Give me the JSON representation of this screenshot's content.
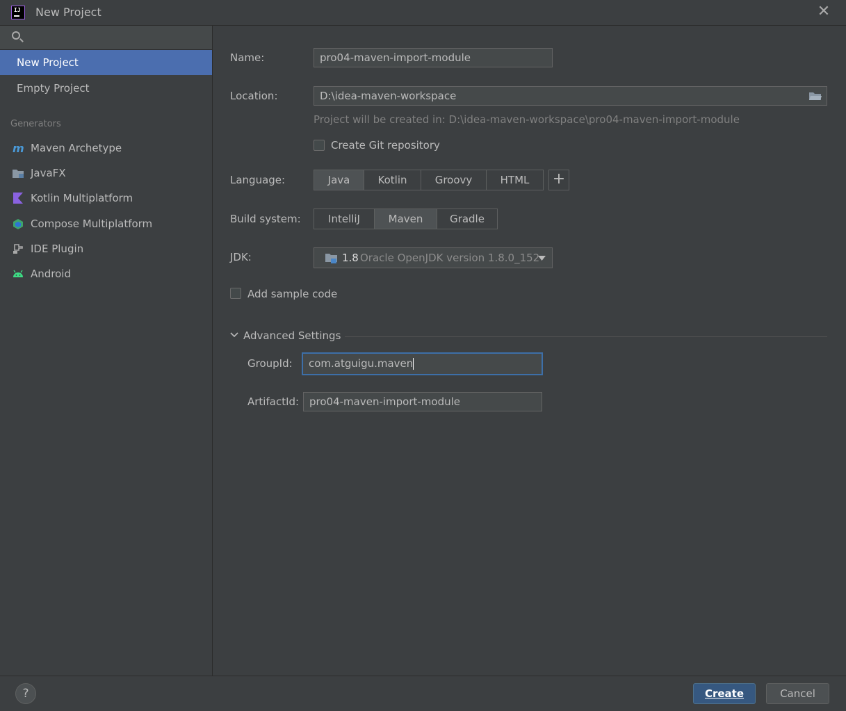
{
  "window": {
    "title": "New Project",
    "close_icon": "close-icon"
  },
  "sidebar": {
    "search_placeholder": "",
    "items": [
      {
        "label": "New Project",
        "selected": true
      },
      {
        "label": "Empty Project",
        "selected": false
      }
    ],
    "section_title": "Generators",
    "generators": [
      {
        "label": "Maven Archetype",
        "icon": "maven-icon"
      },
      {
        "label": "JavaFX",
        "icon": "javafx-icon"
      },
      {
        "label": "Kotlin Multiplatform",
        "icon": "kotlin-icon"
      },
      {
        "label": "Compose Multiplatform",
        "icon": "compose-icon"
      },
      {
        "label": "IDE Plugin",
        "icon": "plugin-icon"
      },
      {
        "label": "Android",
        "icon": "android-icon"
      }
    ]
  },
  "form": {
    "name_label": "Name:",
    "name_value": "pro04-maven-import-module",
    "location_label": "Location:",
    "location_value": "D:\\idea-maven-workspace",
    "location_hint": "Project will be created in: D:\\idea-maven-workspace\\pro04-maven-import-module",
    "git_label": "Create Git repository",
    "language_label": "Language:",
    "languages": [
      "Java",
      "Kotlin",
      "Groovy",
      "HTML"
    ],
    "language_selected": "Java",
    "add_language_label": "+",
    "build_label": "Build system:",
    "build_systems": [
      "IntelliJ",
      "Maven",
      "Gradle"
    ],
    "build_selected": "Maven",
    "jdk_label": "JDK:",
    "jdk_version": "1.8",
    "jdk_detail": "Oracle OpenJDK version 1.8.0_152",
    "sample_label": "Add sample code",
    "advanced_label": "Advanced Settings",
    "groupid_label": "GroupId:",
    "groupid_value": "com.atguigu.maven",
    "artifactid_label": "ArtifactId:",
    "artifactid_value": "pro04-maven-import-module"
  },
  "footer": {
    "help_label": "?",
    "create_label": "Create",
    "cancel_label": "Cancel"
  },
  "colors": {
    "background": "#3c3f41",
    "selection": "#4b6eaf",
    "primary_button": "#365880",
    "focus_border": "#3d6fa8"
  }
}
